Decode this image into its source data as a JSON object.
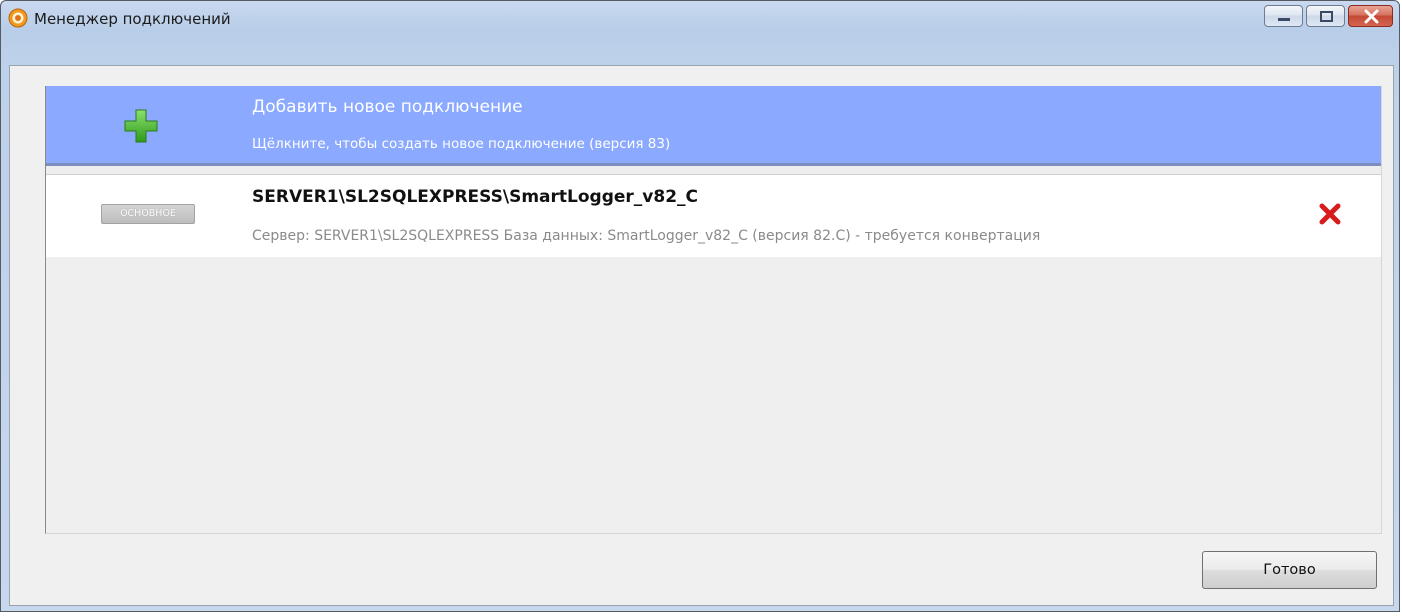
{
  "window": {
    "title": "Менеджер подключений",
    "icon": "app-gear-icon"
  },
  "caption_buttons": {
    "minimize": "minimize-icon",
    "maximize": "maximize-icon",
    "close": "close-icon"
  },
  "add_connection": {
    "icon": "plus-icon",
    "title": "Добавить новое подключение",
    "subtitle": "Щёлкните, чтобы создать новое подключение (версия 83)"
  },
  "connections": [
    {
      "badge": "ОСНОВНОЕ",
      "title": "SERVER1\\SL2SQLEXPRESS\\SmartLogger_v82_C",
      "details": "Сервер: SERVER1\\SL2SQLEXPRESS База данных: SmartLogger_v82_C (версия 82.C)  - требуется конвертация",
      "delete_icon": "delete-x-icon"
    }
  ],
  "footer": {
    "done_label": "Готово"
  },
  "colors": {
    "selected_row": "#8aa9ff",
    "delete": "#e02020",
    "plus": "#3fb82a"
  }
}
